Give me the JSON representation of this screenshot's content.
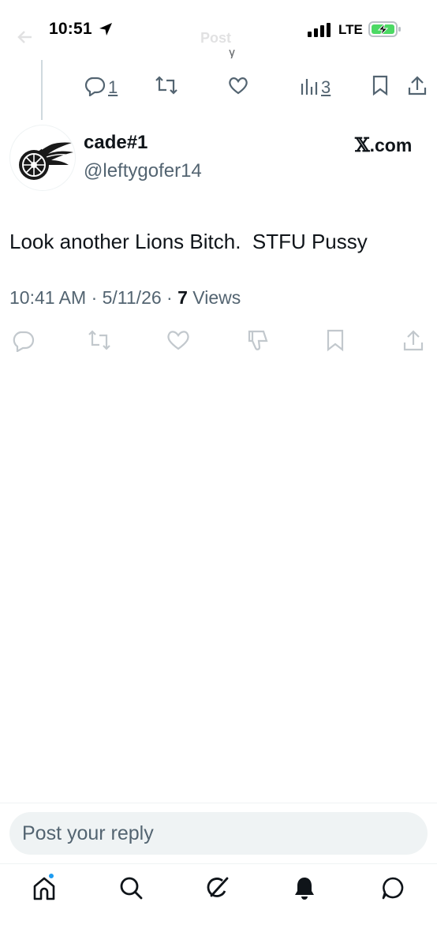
{
  "status_bar": {
    "time": "10:51",
    "network": "LTE",
    "icons": [
      "location-arrow-icon",
      "signal-icon",
      "battery-charging-icon"
    ],
    "battery_color": "#4cd964"
  },
  "header": {
    "title": "Post",
    "back_icon": "back-arrow-icon"
  },
  "previous_post": {
    "reply_count": "1",
    "views_count": "3"
  },
  "post": {
    "display_name": "cade#1",
    "handle": "@leftygofer14",
    "source_link": ".com",
    "source_logo": "𝕏",
    "text": "Look another Lions Bitch.  STFU Pussy",
    "timestamp": "10:41 AM · 5/11/26 · ",
    "views_count": "7",
    "views_label": " Views",
    "avatar": "winged-wheel-logo"
  },
  "reply": {
    "placeholder": "Post your reply"
  },
  "nav": {
    "items": [
      "home-icon",
      "search-icon",
      "grok-icon",
      "notifications-icon",
      "messages-icon"
    ],
    "notification_dot_color": "#1d9bf0"
  },
  "colors": {
    "text_primary": "#0f1419",
    "text_secondary": "#536471",
    "accent": "#1d9bf0",
    "divider": "#eff3f4"
  }
}
